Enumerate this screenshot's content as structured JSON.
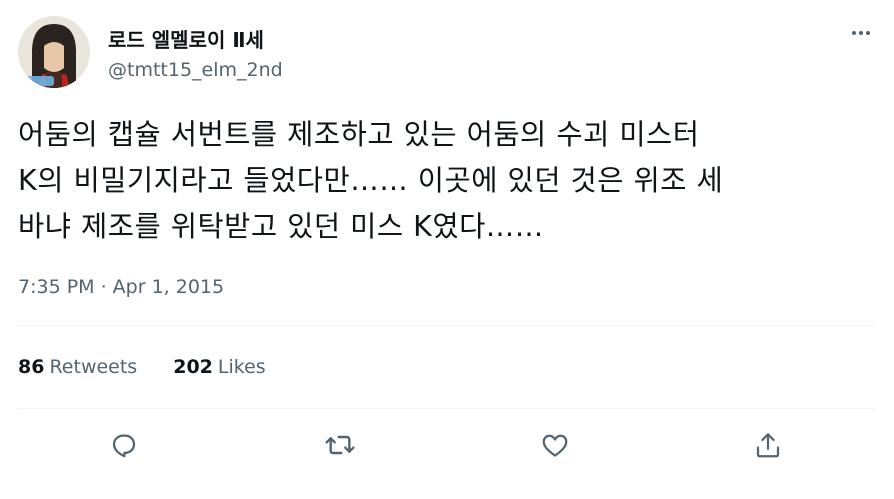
{
  "author": {
    "display_name": "로드 엘멜로이 Ⅱ세",
    "handle": "@tmtt15_elm_2nd"
  },
  "tweet": {
    "line1": "어둠의 캡슐 서번트를 제조하고 있는 어둠의 수괴 미스터",
    "line2": "K의 비밀기지라고 들었다만…… 이곳에 있던 것은 위조 세",
    "line3": "바냐 제조를 위탁받고 있던 미스 K였다……",
    "timestamp": "7:35 PM · Apr 1, 2015"
  },
  "stats": {
    "retweets_count": "86",
    "retweets_label": "Retweets",
    "likes_count": "202",
    "likes_label": "Likes"
  },
  "icons": {
    "more": "more-dots-icon",
    "reply": "reply-icon",
    "retweet": "retweet-icon",
    "like": "heart-icon",
    "share": "share-icon"
  },
  "colors": {
    "text": "#0f1419",
    "secondary": "#536471",
    "divider": "#eff3f4"
  }
}
